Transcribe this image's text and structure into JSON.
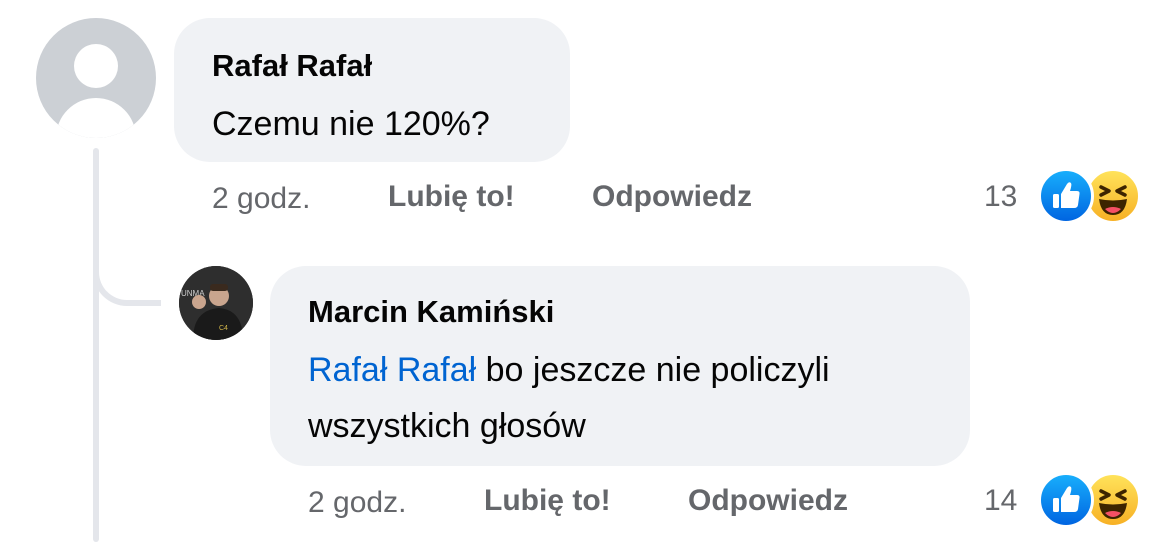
{
  "comment": {
    "author": "Rafał Rafał",
    "text": "Czemu nie 120%?",
    "time": "2 godz.",
    "like_label": "Lubię to!",
    "reply_label": "Odpowiedz",
    "reaction_count": "13",
    "reactions": [
      "like-icon",
      "haha-icon"
    ]
  },
  "reply": {
    "author": "Marcin Kamiński",
    "mention": "Rafał Rafał",
    "text_line1": " bo jeszcze nie policzyli",
    "text_line2": "wszystkich głosów",
    "time": "2 godz.",
    "like_label": "Lubię to!",
    "reply_label": "Odpowiedz",
    "reaction_count": "14",
    "reactions": [
      "like-icon",
      "haha-icon"
    ]
  },
  "colors": {
    "bubble": "#f0f2f5",
    "mention": "#0064d1",
    "meta": "#65676b",
    "thread_line": "#e4e6eb"
  }
}
